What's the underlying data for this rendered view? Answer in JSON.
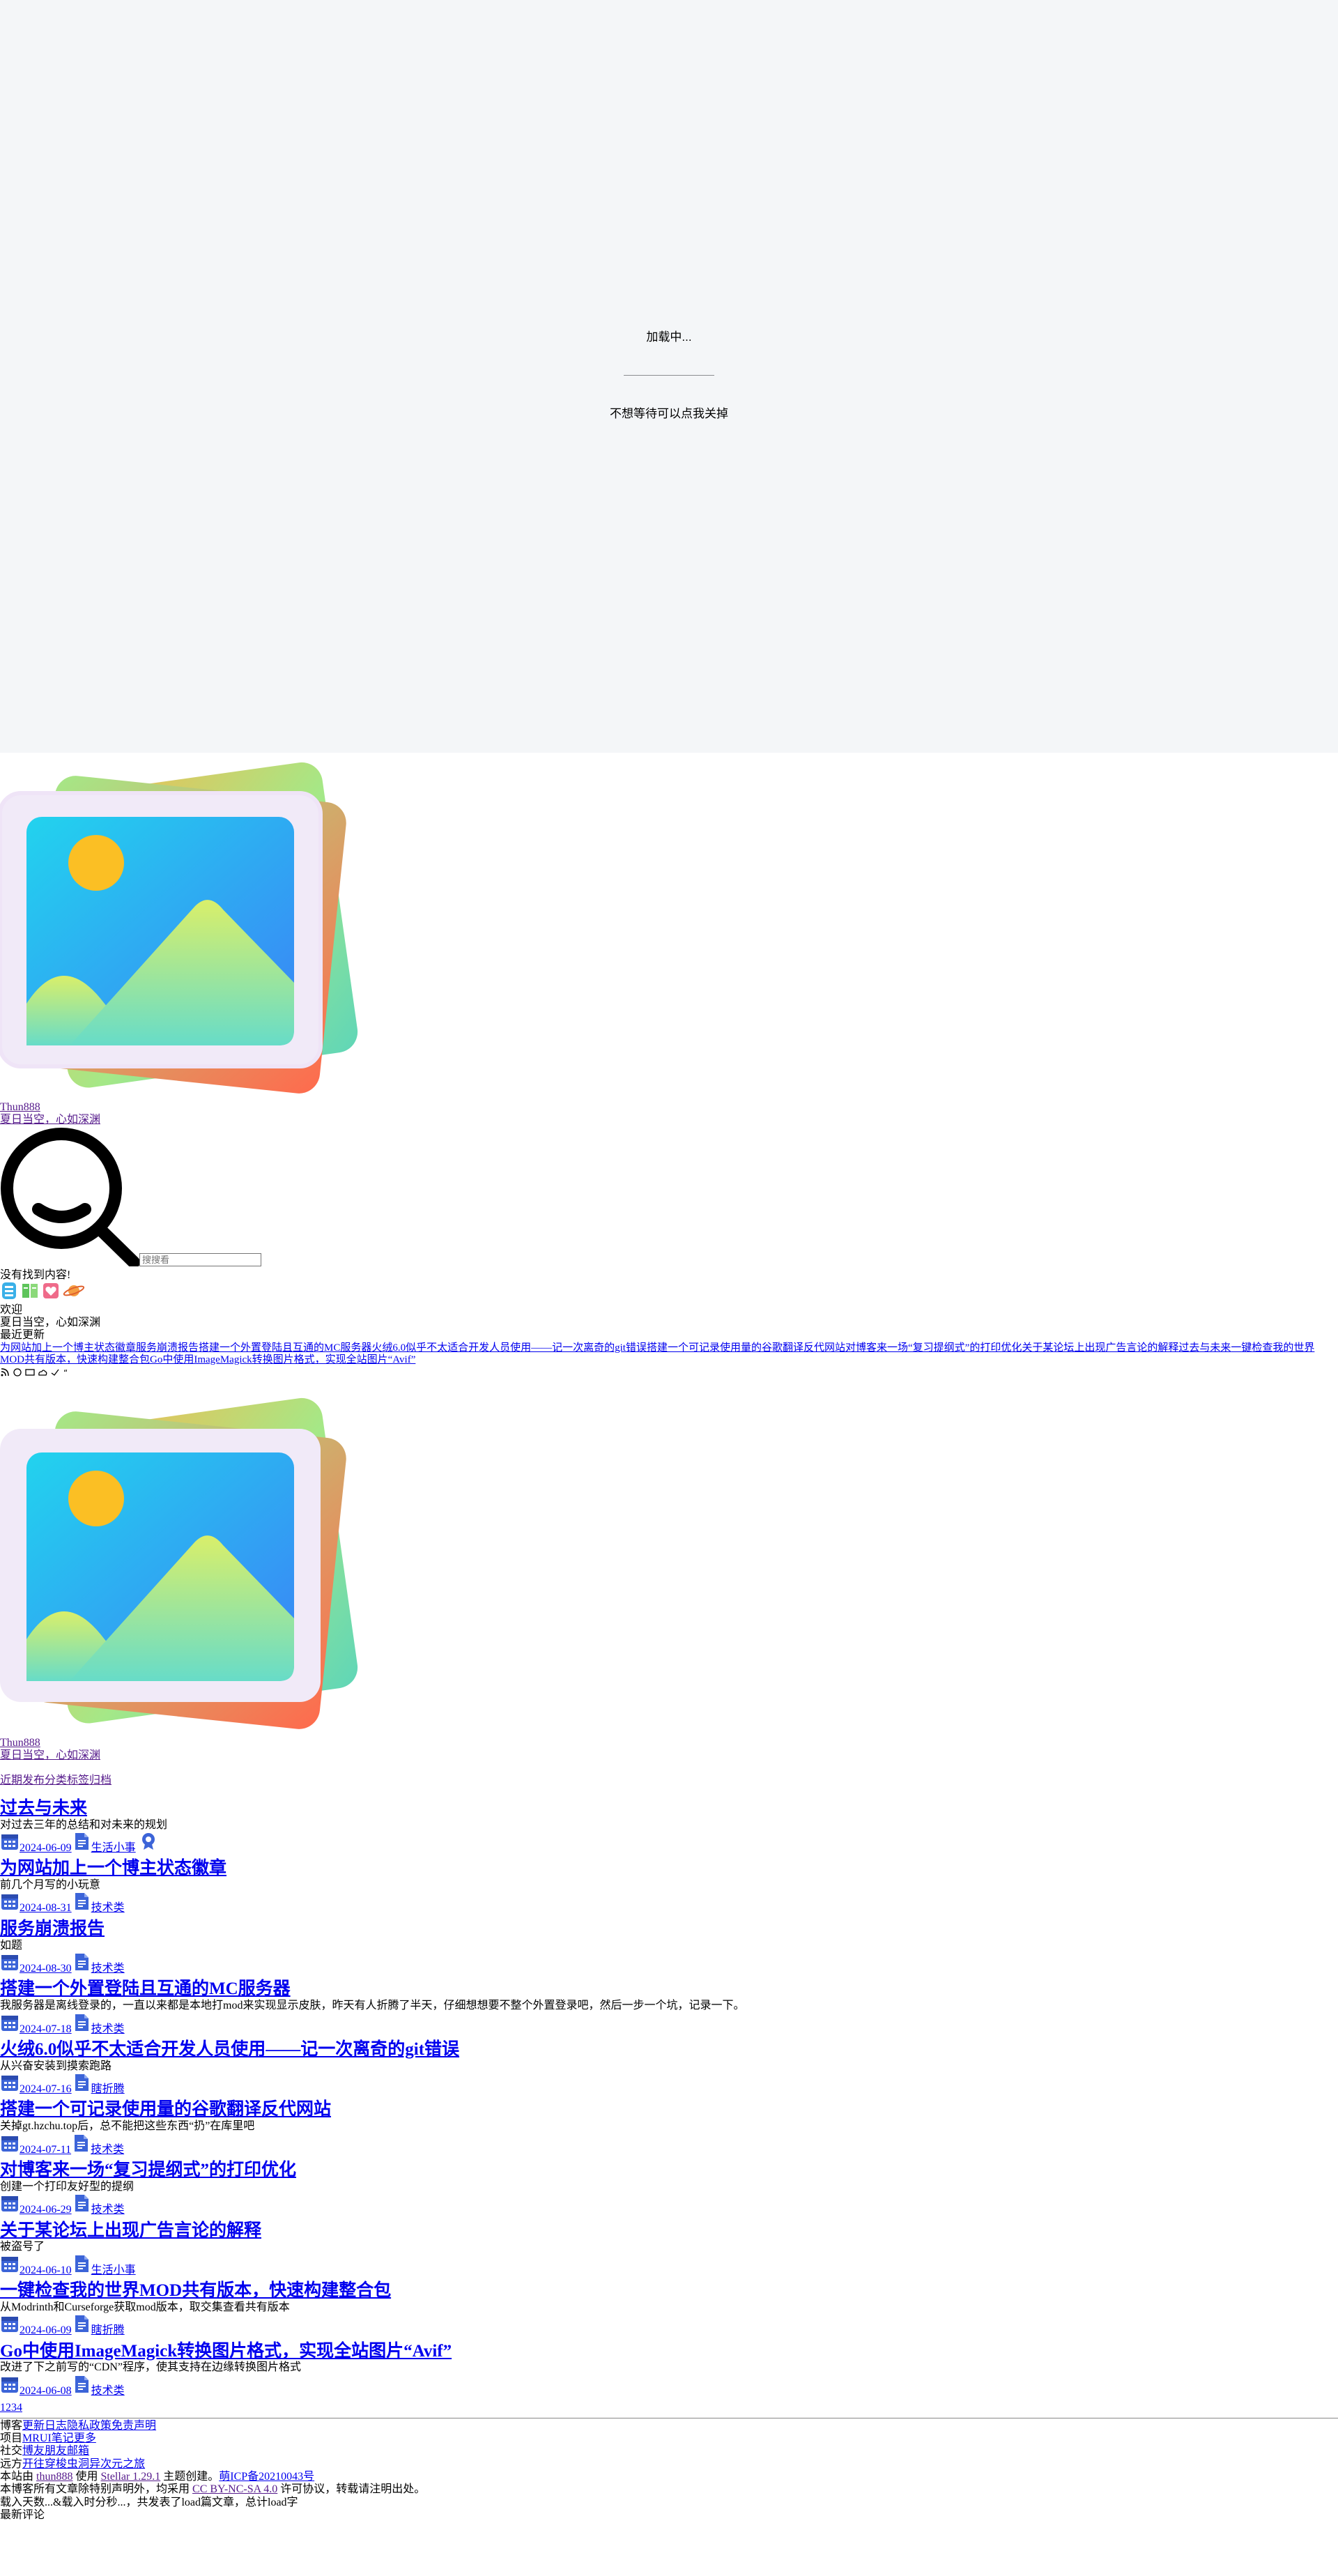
{
  "loading": {
    "text": "加载中...",
    "skip": "不想等待可以点我关掉"
  },
  "profile": {
    "name": "Thun888",
    "subtitle": "夏日当空，心如深渊"
  },
  "search": {
    "placeholder": "搜搜看",
    "no_result": "没有找到内容!"
  },
  "widgets": {
    "welcome": "欢迎",
    "welcome_sub": "夏日当空，心如深渊",
    "recent_title": "最近更新",
    "recent_links": [
      "为网站加上一个博主状态徽章",
      "服务崩溃报告",
      "搭建一个外置登陆且互通的MC服务器",
      "火绒6.0似乎不太适合开发人员使用——记一次离奇的git错误",
      "搭建一个可记录使用量的谷歌翻译反代网站",
      "对博客来一场“复习提纲式”的打印优化",
      "关于某论坛上出现广告言论的解释",
      "过去与未来",
      "一键检查我的世界MOD共有版本，快速构建整合包",
      "Go中使用ImageMagick转换图片格式，实现全站图片“Avif”"
    ]
  },
  "profile2": {
    "name": "Thun888",
    "subtitle": "夏日当空，心如深渊"
  },
  "nav": [
    "近期发布",
    "分类",
    "标签",
    "归档"
  ],
  "posts": [
    {
      "title": "过去与未来",
      "excerpt": "对过去三年的总结和对未来的规划",
      "date": "2024-06-09",
      "cat": "生活小事",
      "pinned": true
    },
    {
      "title": "为网站加上一个博主状态徽章",
      "excerpt": "前几个月写的小玩意",
      "date": "2024-08-31",
      "cat": "技术类"
    },
    {
      "title": "服务崩溃报告",
      "excerpt": "如题",
      "date": "2024-08-30",
      "cat": "技术类"
    },
    {
      "title": "搭建一个外置登陆且互通的MC服务器",
      "excerpt": "我服务器是离线登录的，一直以来都是本地打mod来实现显示皮肤，昨天有人折腾了半天，仔细想想要不整个外置登录吧，然后一步一个坑，记录一下。",
      "date": "2024-07-18",
      "cat": "技术类"
    },
    {
      "title": "火绒6.0似乎不太适合开发人员使用——记一次离奇的git错误",
      "excerpt": "从兴奋安装到摸索跑路",
      "date": "2024-07-16",
      "cat": "瞎折腾"
    },
    {
      "title": "搭建一个可记录使用量的谷歌翻译反代网站",
      "excerpt": "关掉gt.hzchu.top后，总不能把这些东西“扔”在库里吧",
      "date": "2024-07-11",
      "cat": "技术类"
    },
    {
      "title": "对博客来一场“复习提纲式”的打印优化",
      "excerpt": "创建一个打印友好型的提纲",
      "date": "2024-06-29",
      "cat": "技术类"
    },
    {
      "title": "关于某论坛上出现广告言论的解释",
      "excerpt": "被盗号了",
      "date": "2024-06-10",
      "cat": "生活小事"
    },
    {
      "title": "一键检查我的世界MOD共有版本，快速构建整合包",
      "excerpt": "从Modrinth和Curseforge获取mod版本，取交集查看共有版本",
      "date": "2024-06-09",
      "cat": "瞎折腾"
    },
    {
      "title": "Go中使用ImageMagick转换图片格式，实现全站图片“Avif”",
      "excerpt": "改进了下之前写的“CDN”程序，使其支持在边缘转换图片格式",
      "date": "2024-06-08",
      "cat": "技术类"
    }
  ],
  "pagination": [
    "1",
    "2",
    "3",
    "4"
  ],
  "footer": {
    "blog_label": "博客",
    "blog_links": [
      "更新日志",
      "隐私政策",
      "免责声明"
    ],
    "project_label": "项目",
    "project_links": [
      "MRUI",
      "笔记",
      "更多"
    ],
    "social_label": "社交",
    "social_links": [
      "博友",
      "朋友",
      "邮箱"
    ],
    "far_label": "远方",
    "far_links": [
      "开往",
      "穿梭",
      "虫洞",
      "异次元之旅"
    ],
    "site_pre": "本站由",
    "site_author": "thun888",
    "site_use": "使用",
    "theme": "Stellar 1.29.1",
    "theme_post": "主题创建。",
    "icp": "萌ICP备20210043号",
    "license_pre": "本博客所有文章除特别声明外，均采用",
    "license": "CC BY-NC-SA 4.0",
    "license_post": "许可协议，转载请注明出处。",
    "stats": "载入天数...&载入时分秒...，共发表了load篇文章，总计load字",
    "recent_comments": "最新评论"
  },
  "colors": {
    "loading_bg": "#f4f6f8",
    "link": "#0000ee",
    "visited": "#551a8b",
    "icon_blue": "#3c64d8"
  }
}
